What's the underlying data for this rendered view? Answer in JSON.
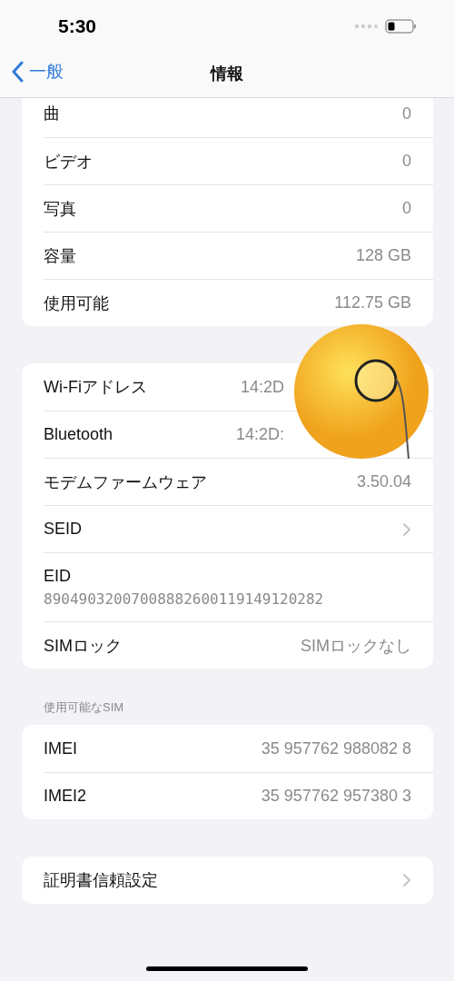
{
  "status_bar": {
    "time": "5:30"
  },
  "nav": {
    "back": "一般",
    "title": "情報"
  },
  "groups": [
    {
      "rows": [
        {
          "kind": "value",
          "label": "曲",
          "value": "0"
        },
        {
          "kind": "value",
          "label": "ビデオ",
          "value": "0"
        },
        {
          "kind": "value",
          "label": "写真",
          "value": "0"
        },
        {
          "kind": "value",
          "label": "容量",
          "value": "128 GB"
        },
        {
          "kind": "value",
          "label": "使用可能",
          "value": "112.75 GB"
        }
      ]
    },
    {
      "rows": [
        {
          "kind": "covered",
          "label": "Wi-Fiアドレス",
          "value": "14:2D"
        },
        {
          "kind": "covered",
          "label": "Bluetooth",
          "value": "14:2D:"
        },
        {
          "kind": "value",
          "label": "モデムファームウェア",
          "value": "3.50.04"
        },
        {
          "kind": "chevron",
          "label": "SEID"
        },
        {
          "kind": "stacked",
          "label": "EID",
          "value": "89049032007008882600119149120282"
        },
        {
          "kind": "value",
          "label": "SIMロック",
          "value": "SIMロックなし"
        }
      ]
    },
    {
      "header": "使用可能なSIM",
      "rows": [
        {
          "kind": "value",
          "label": "IMEI",
          "value": "35 957762 988082 8"
        },
        {
          "kind": "value",
          "label": "IMEI2",
          "value": "35 957762 957380 3"
        }
      ]
    },
    {
      "rows": [
        {
          "kind": "chevron",
          "label": "証明書信頼設定"
        }
      ]
    }
  ]
}
